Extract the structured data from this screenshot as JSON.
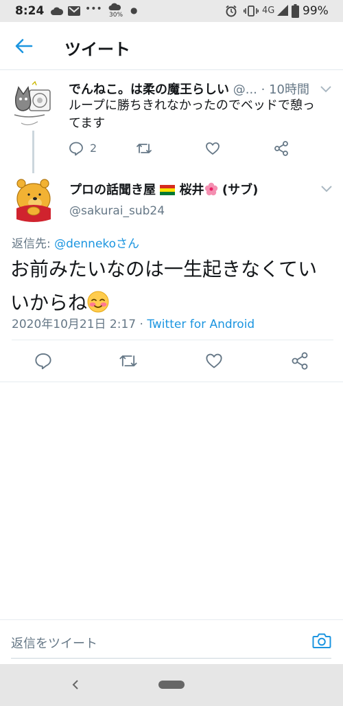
{
  "status": {
    "time": "8:24",
    "signal_badge": "30%",
    "network": "4G",
    "battery": "99%"
  },
  "header": {
    "title": "ツイート"
  },
  "parent_tweet": {
    "name": "でんねこ。は柔の魔王らしい",
    "handle": "@...",
    "time": "· 10時間",
    "text_line1": "ループに勝ちきれなかったのでベッドで憩っ",
    "text_line2": "てます",
    "reply_count": "2"
  },
  "main_tweet": {
    "name_part1": "プロの話聞き屋",
    "name_part2": "桜井",
    "name_part3": "(サブ)",
    "handle": "@sakurai_sub24",
    "reply_prefix": "返信先: ",
    "reply_to": "@dennekoさん",
    "text_line1": "お前みたいなのは一生起きなくてい",
    "text_line2": "いからね",
    "date": "2020年10月21日 2:17 · ",
    "source": "Twitter for Android"
  },
  "compose": {
    "placeholder": "返信をツイート"
  },
  "colors": {
    "accent": "#1b95e0",
    "muted": "#657786"
  }
}
